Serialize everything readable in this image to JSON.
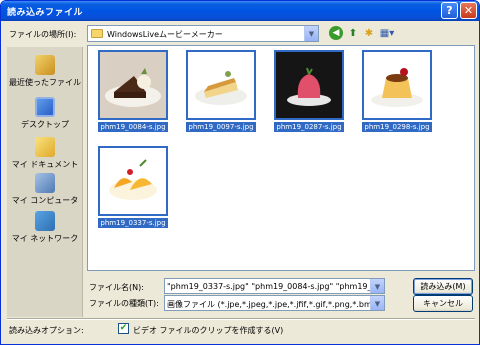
{
  "window": {
    "title": "読み込みファイル",
    "help_glyph": "?",
    "close_glyph": "✕"
  },
  "lookin": {
    "label": "ファイルの場所(I):",
    "value": "WindowsLiveムービーメーカー"
  },
  "places": [
    {
      "label": "最近使ったファイル",
      "icon": "recent-documents-icon"
    },
    {
      "label": "デスクトップ",
      "icon": "desktop-icon"
    },
    {
      "label": "マイ ドキュメント",
      "icon": "my-documents-icon"
    },
    {
      "label": "マイ コンピュータ",
      "icon": "my-computer-icon"
    },
    {
      "label": "マイ ネットワーク",
      "icon": "my-network-icon"
    }
  ],
  "files": [
    {
      "name": "phm19_0084-s.jpg",
      "subject": "chocolate cake with ice cream"
    },
    {
      "name": "phm19_0097-s.jpg",
      "subject": "cheesecake slice"
    },
    {
      "name": "phm19_0287-s.jpg",
      "subject": "pink panna cotta"
    },
    {
      "name": "phm19_0298-s.jpg",
      "subject": "custard pudding"
    },
    {
      "name": "phm19_0337-s.jpg",
      "subject": "fruit jelly with orange slices"
    }
  ],
  "filename": {
    "label": "ファイル名(N):",
    "value": "\"phm19_0337-s.jpg\" \"phm19_0084-s.jpg\" \"phm19_0097-s"
  },
  "filetype": {
    "label": "ファイルの種類(T):",
    "value": "画像ファイル (*.jpe,*.jpeg,*.jpe,*.jfif,*.gif,*.png,*.bmp,*.dib,*."
  },
  "buttons": {
    "open": "読み込み(M)",
    "cancel": "キャンセル"
  },
  "options": {
    "label": "読み込みオプション:",
    "checkbox_label": "ビデオ ファイルのクリップを作成する(V)",
    "checked": true
  },
  "colors": {
    "titlebar": "#0054e3",
    "selection": "#316ac5",
    "dialog_bg": "#ece9d8"
  }
}
